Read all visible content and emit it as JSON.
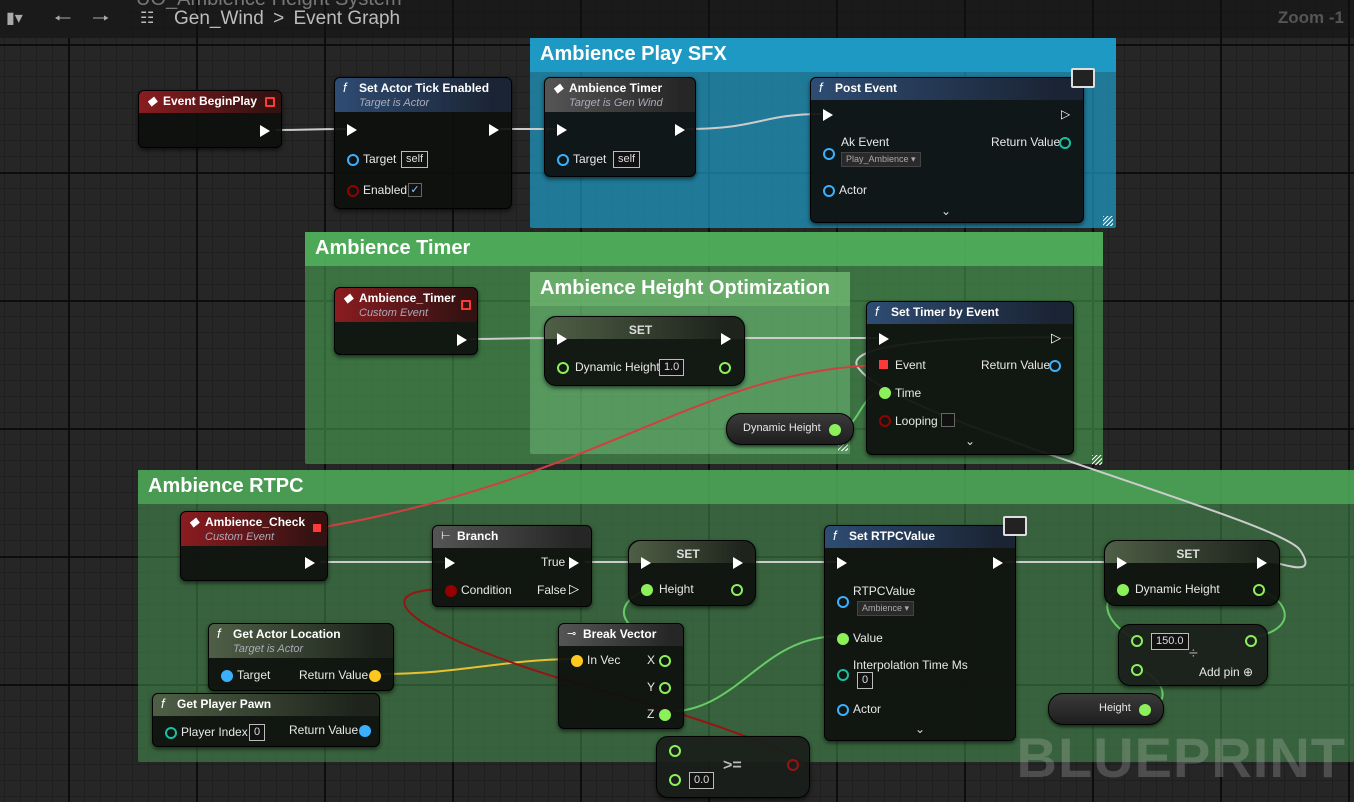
{
  "topbar": {
    "title": "UO_Ambience Height System",
    "blueprint": "Gen_Wind",
    "graph": "Event Graph",
    "separator": ">",
    "zoom": "Zoom -1"
  },
  "comments": {
    "play_sfx": "Ambience Play SFX",
    "timer": "Ambience Timer",
    "optimization": "Ambience Height Optimization",
    "rtpc": "Ambience RTPC"
  },
  "nodes": {
    "begin_play": {
      "title": "Event BeginPlay"
    },
    "tick_enabled": {
      "title": "Set Actor Tick Enabled",
      "sub": "Target is Actor",
      "target": "Target",
      "target_val": "self",
      "enabled": "Enabled"
    },
    "amb_timer_call": {
      "title": "Ambience Timer",
      "sub": "Target is Gen Wind",
      "target": "Target",
      "target_val": "self"
    },
    "post_event": {
      "title": "Post Event",
      "ak_event": "Ak Event",
      "ak_val": "Play_Ambience",
      "return": "Return Value",
      "actor": "Actor"
    },
    "amb_timer_event": {
      "title": "Ambience_Timer",
      "sub": "Custom Event"
    },
    "set_dyn": {
      "title": "SET",
      "var": "Dynamic Height",
      "val": "1.0"
    },
    "set_timer": {
      "title": "Set Timer by Event",
      "event": "Event",
      "return": "Return Value",
      "time": "Time",
      "looping": "Looping"
    },
    "dyn_get": {
      "label": "Dynamic Height"
    },
    "amb_check": {
      "title": "Ambience_Check",
      "sub": "Custom Event"
    },
    "branch": {
      "title": "Branch",
      "true": "True",
      "false": "False",
      "cond": "Condition"
    },
    "set_height": {
      "title": "SET",
      "var": "Height"
    },
    "set_rtpc": {
      "title": "Set RTPCValue",
      "rtpc": "RTPCValue",
      "rtpc_val": "Ambience",
      "value": "Value",
      "interp": "Interpolation Time Ms",
      "interp_val": "0",
      "actor": "Actor"
    },
    "set_dyn2": {
      "title": "SET",
      "var": "Dynamic Height"
    },
    "add": {
      "val": "150.0",
      "addpin": "Add pin"
    },
    "height_get": {
      "label": "Height"
    },
    "get_loc": {
      "title": "Get Actor Location",
      "sub": "Target is Actor",
      "target": "Target",
      "return": "Return Value"
    },
    "break_vec": {
      "title": "Break Vector",
      "in": "In Vec",
      "x": "X",
      "y": "Y",
      "z": "Z"
    },
    "player_pawn": {
      "title": "Get Player Pawn",
      "index": "Player Index",
      "index_val": "0",
      "return": "Return Value"
    },
    "compare": {
      "op": ">=",
      "val": "0.0"
    }
  },
  "watermark": "BLUEPRINT",
  "icons": [
    "bookmark-icon",
    "back-arrow-icon",
    "forward-arrow-icon",
    "graph-icon",
    "function-icon",
    "event-icon",
    "monitor-icon",
    "chevron-down-icon"
  ],
  "colors": {
    "exec": "#ffffff",
    "float": "#8cf05a",
    "object": "#3ab0ff",
    "bool": "#950000",
    "vector": "#ffc81e",
    "delegate": "#ff3838",
    "comment_blue": "#1e9cc8",
    "comment_green": "#4fae5a"
  }
}
